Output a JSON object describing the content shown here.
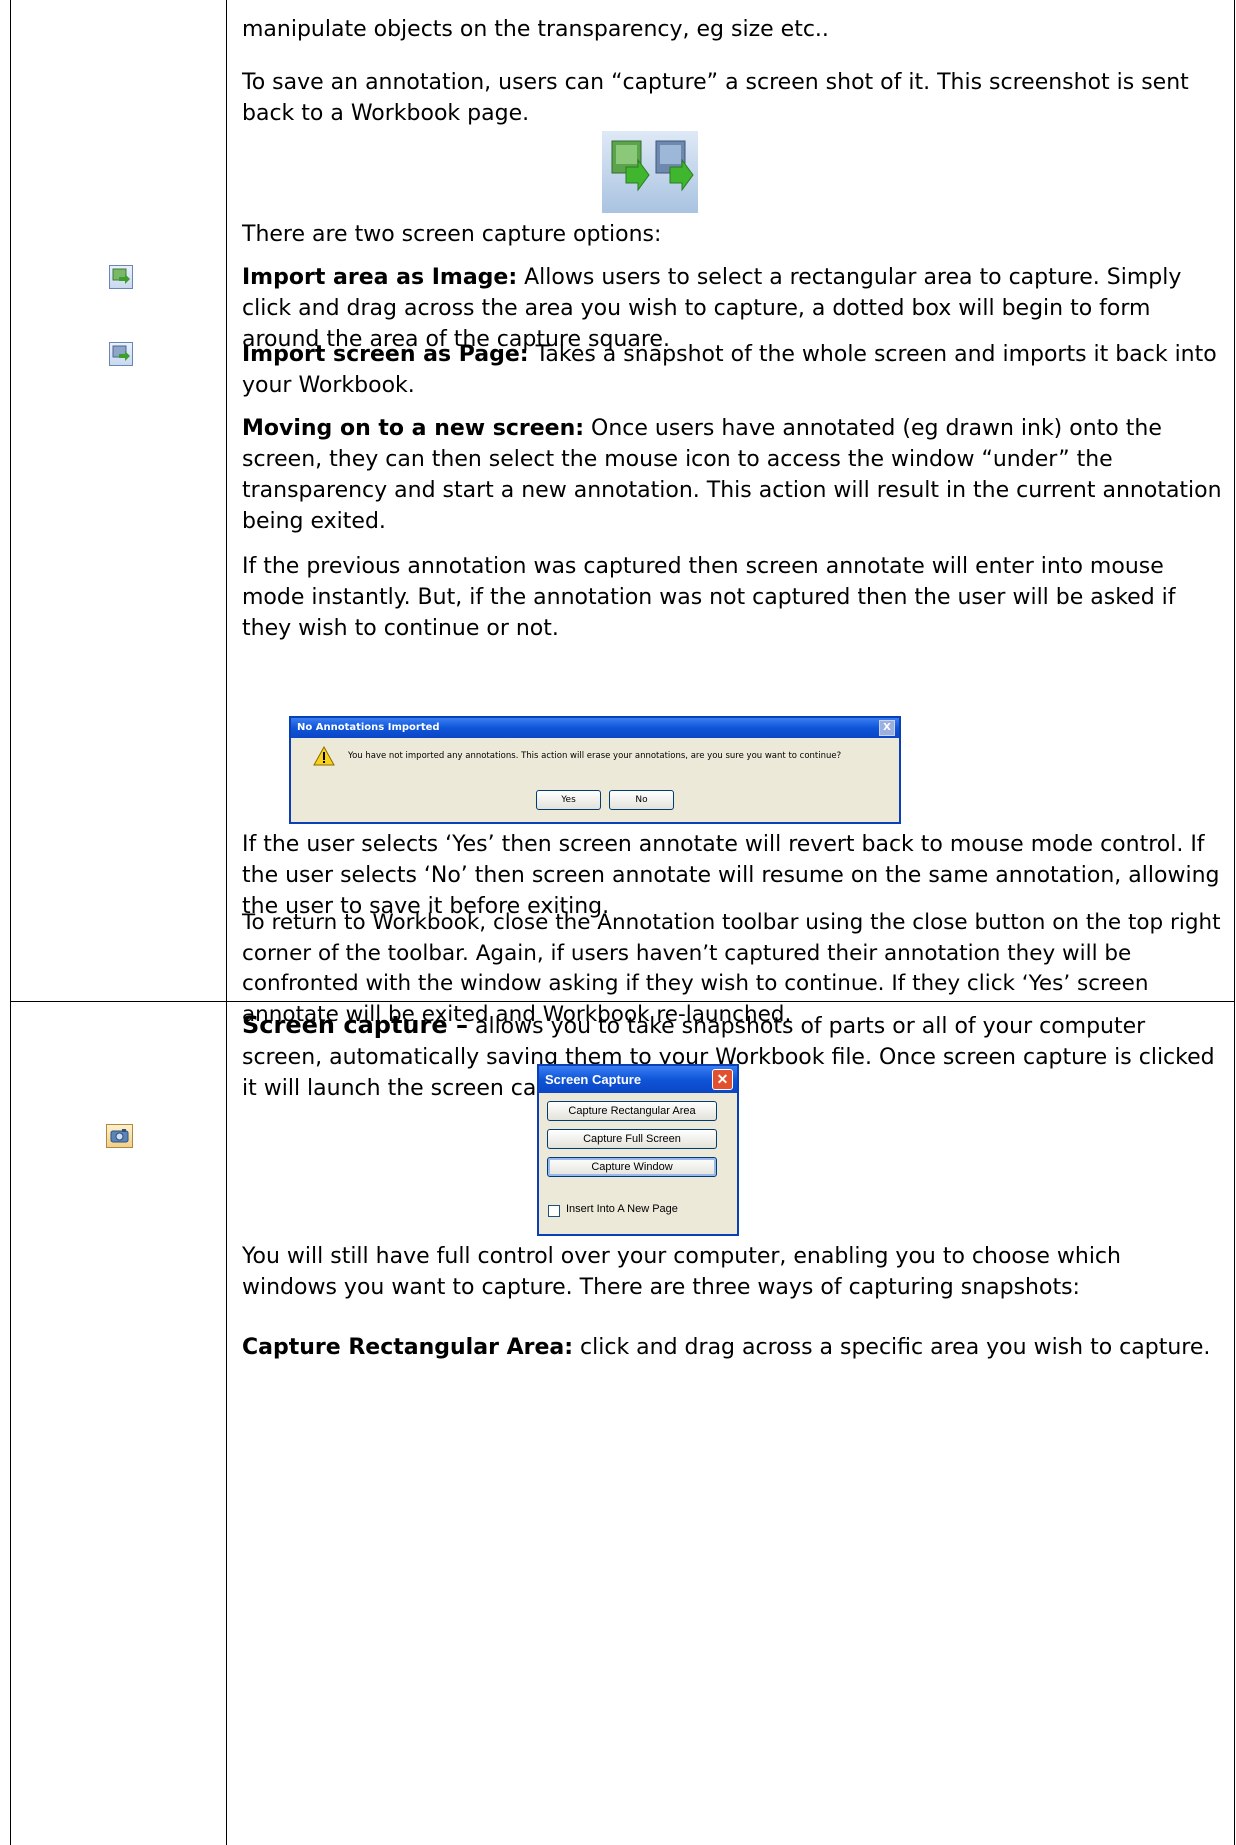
{
  "row1": {
    "line_manipulate": "manipulate objects on the transparency, eg size etc..",
    "save_annotation": "To save an annotation, users can “capture” a screen shot of it.  This screenshot is sent back to a Workbook page.",
    "two_options": "There are two screen capture options:",
    "import_area": {
      "heading": "Import area as Image:",
      "text": " Allows users to select a rectangular area to capture.  Simply click and drag across the area you wish to capture, a dotted box will begin to form around the area of the capture square."
    },
    "import_screen": {
      "heading": "Import screen as Page:",
      "text": " Takes a snapshot of the whole screen and imports it back into your Workbook."
    },
    "moving_on": {
      "heading": "Moving on to a new screen:",
      "text": " Once users have annotated (eg drawn ink) onto the screen, they can then select the mouse icon to access the window “under” the transparency and start a new annotation.  This action will result in the current annotation being exited."
    },
    "previous_captured": "If the previous annotation was captured then screen annotate will enter into mouse mode instantly.  But, if the annotation was not captured then the user will be asked if they wish to continue or not.",
    "dialog": {
      "title": "No Annotations Imported",
      "message": "You have not imported any annotations. This action will erase your annotations, are you sure you want to continue?",
      "yes": "Yes",
      "no": "No",
      "close": "X"
    },
    "selects_yes": "If the user selects ‘Yes’ then screen annotate will revert back to mouse mode control.  If the user selects ‘No’ then screen annotate will resume on the same annotation, allowing the user to save it before exiting.",
    "return_workbook": "To return to Workbook, close the Annotation toolbar using the close button on the top right corner of the toolbar. Again, if users haven’t captured their annotation they will be confronted with the window asking if they wish to continue.  If they click ‘Yes’ screen annotate will be exited and Workbook re-launched."
  },
  "row2": {
    "screen_capture": {
      "heading": "Screen capture –",
      "text": " allows you to take snapshots of parts or all of your computer screen, automatically saving them to your Workbook file.  Once screen capture is clicked it will launch the screen capture menu."
    },
    "dialog": {
      "title": "Screen Capture",
      "close": "✕",
      "btn_rect": "Capture Rectangular Area",
      "btn_full": "Capture Full Screen",
      "btn_window": "Capture Window",
      "checkbox": "Insert Into A New Page"
    },
    "full_control": "You will still have full control over your computer, enabling you to choose which windows you want to capture.   There are three ways of capturing snapshots:",
    "capture_rect": {
      "heading": "Capture Rectangular Area:",
      "text": " click and drag across a specific area you wish to capture."
    }
  },
  "icons": {
    "import_area": "import-area-icon",
    "import_screen": "import-screen-icon",
    "camera": "camera-icon"
  }
}
